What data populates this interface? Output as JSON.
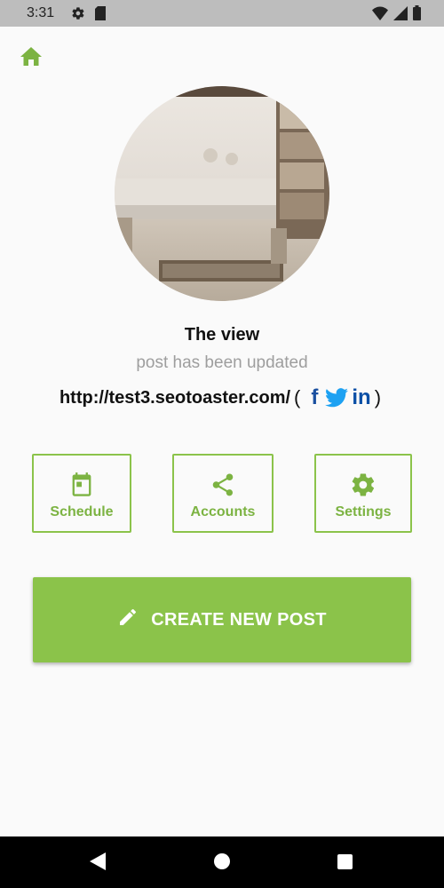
{
  "status_bar": {
    "time": "3:31",
    "icons": [
      "gear-icon",
      "sd-card-icon",
      "wifi-icon",
      "signal-icon",
      "battery-icon"
    ]
  },
  "header": {
    "home_icon": "home-icon"
  },
  "post": {
    "title": "The view",
    "status": "post has been updated",
    "url": "http://test3.seotoaster.com/",
    "paren_open": "(",
    "paren_close": ")",
    "social": {
      "facebook": "f",
      "twitter_icon": "twitter-icon",
      "linkedin": "in"
    }
  },
  "actions": {
    "schedule": {
      "label": "Schedule",
      "icon": "calendar-icon"
    },
    "accounts": {
      "label": "Accounts",
      "icon": "share-icon"
    },
    "settings": {
      "label": "Settings",
      "icon": "gear-icon"
    }
  },
  "create_button": {
    "label": "CREATE NEW POST",
    "icon": "pencil-icon"
  },
  "nav_bar": {
    "icons": [
      "back-icon",
      "home-circle-icon",
      "recents-icon"
    ]
  },
  "colors": {
    "accent": "#8bc34a",
    "accent_text": "#7cb342",
    "background": "#fafafa",
    "facebook": "#1a4fa0",
    "twitter": "#1da1f2",
    "linkedin": "#0b4fa6"
  }
}
